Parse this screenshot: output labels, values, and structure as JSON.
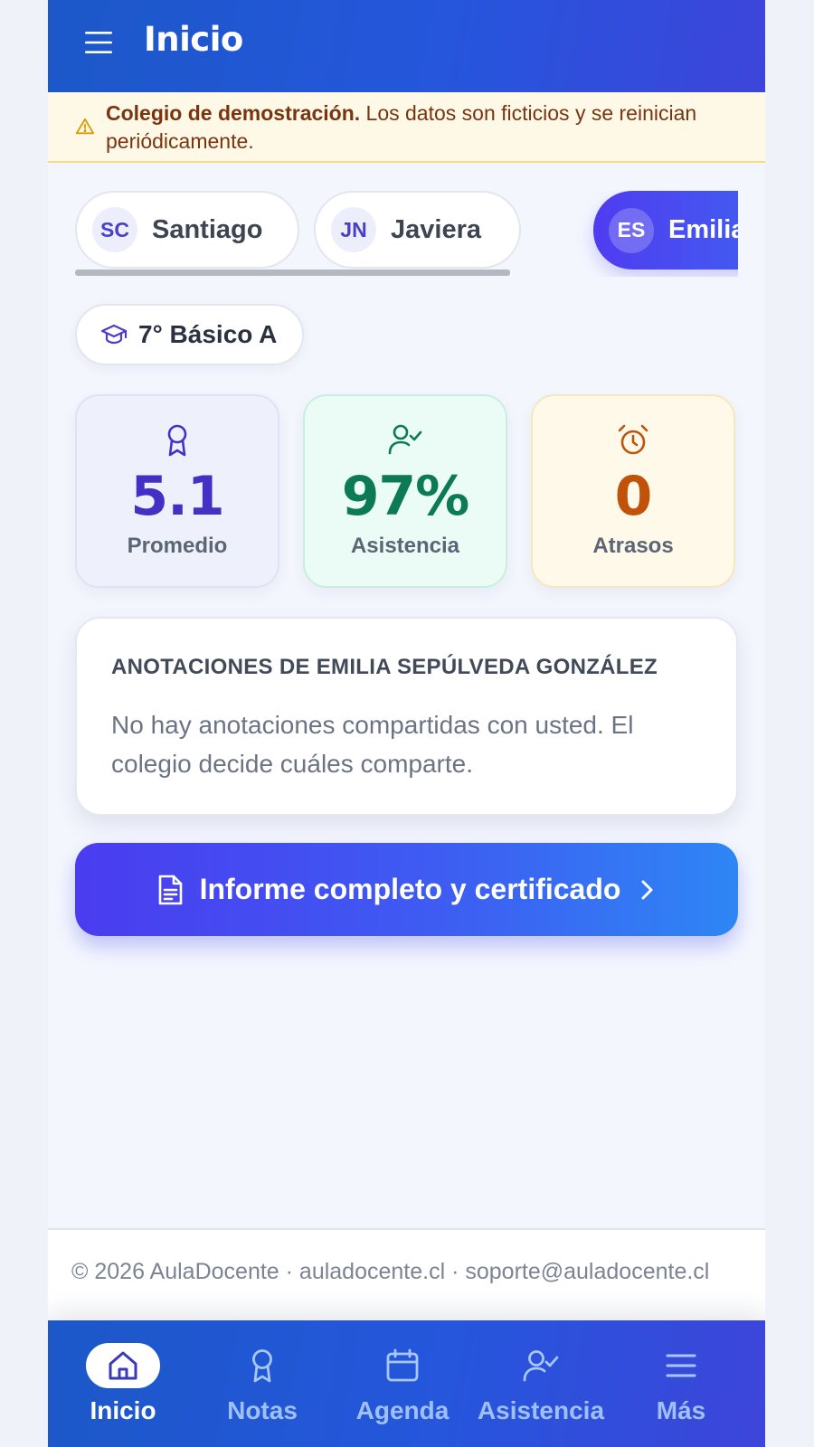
{
  "header": {
    "title": "Inicio",
    "menu_icon": "hamburger-menu-icon"
  },
  "banner": {
    "icon": "warning-triangle-icon",
    "bold": "Colegio de demostración.",
    "text": "Los datos son ficticios y se reinician periódicamente."
  },
  "students": [
    {
      "initials": "SC",
      "name": "Santiago",
      "active": false
    },
    {
      "initials": "JN",
      "name": "Javiera",
      "active": false
    },
    {
      "initials": "ES",
      "name": "Emilia Se",
      "active": true
    }
  ],
  "grade": {
    "icon": "graduation-cap-icon",
    "label": "7° Básico A"
  },
  "stats": [
    {
      "icon": "award-ribbon-icon",
      "value": "5.1",
      "label": "Promedio",
      "color": "#4530c5"
    },
    {
      "icon": "user-check-icon",
      "value": "97%",
      "label": "Asistencia",
      "color": "#0b7a55"
    },
    {
      "icon": "alarm-clock-icon",
      "value": "0",
      "label": "Atrasos",
      "color": "#c0520a"
    }
  ],
  "annotations": {
    "title": "ANOTACIONES DE EMILIA SEPÚLVEDA GONZÁLEZ",
    "body": "No hay anotaciones compartidas con usted. El colegio decide cuáles comparte."
  },
  "report_button": {
    "label": "Informe completo y certificado",
    "icon": "document-icon",
    "chevron": "chevron-right-icon"
  },
  "footer": {
    "text": "© 2026 AulaDocente · auladocente.cl · soporte@auladocente.cl"
  },
  "bottom_nav": [
    {
      "label": "Inicio",
      "icon": "home-icon",
      "active": true
    },
    {
      "label": "Notas",
      "icon": "award-ribbon-icon",
      "active": false
    },
    {
      "label": "Agenda",
      "icon": "calendar-icon",
      "active": false
    },
    {
      "label": "Asistencia",
      "icon": "user-check-icon",
      "active": false
    },
    {
      "label": "Más",
      "icon": "hamburger-menu-icon",
      "active": false
    }
  ],
  "colors": {
    "brand": "#2556dc",
    "accent": "#4f3cf0",
    "banner_bg": "#fef9e7",
    "banner_text": "#7a3410"
  }
}
